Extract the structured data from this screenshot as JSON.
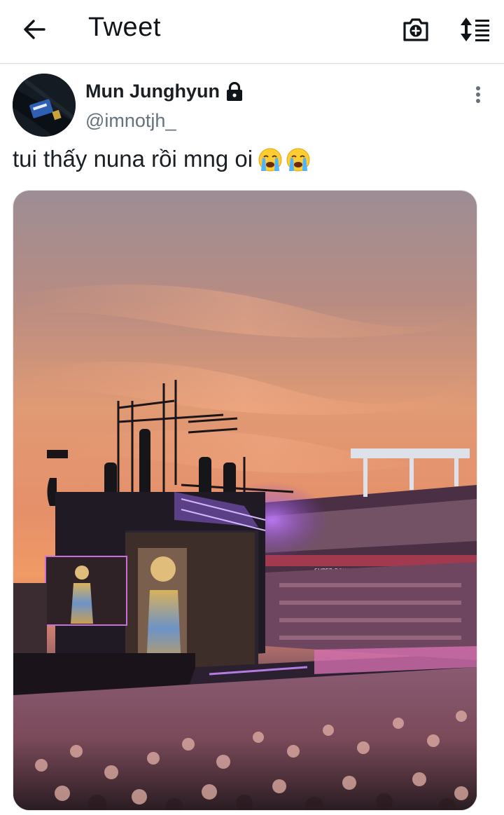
{
  "header": {
    "title": "Tweet",
    "back_icon": "arrow-left-icon",
    "camera_icon": "camera-add-icon",
    "sort_icon": "sort-icon"
  },
  "tweet": {
    "author_name": "Mun Junghyun",
    "author_handle": "@imnotjh_",
    "protected_icon": "lock-icon",
    "text": "tui thấy nuna rồi mng oi",
    "emojis": [
      "😭",
      "😭"
    ],
    "more_icon": "more-vertical-icon"
  },
  "media": {
    "scoreboard_text": "SUPER BOWL CHAMPIONS 2002 2020"
  },
  "colors": {
    "text": "#0f1419",
    "muted": "#65717c",
    "divider": "#d9dee2"
  }
}
